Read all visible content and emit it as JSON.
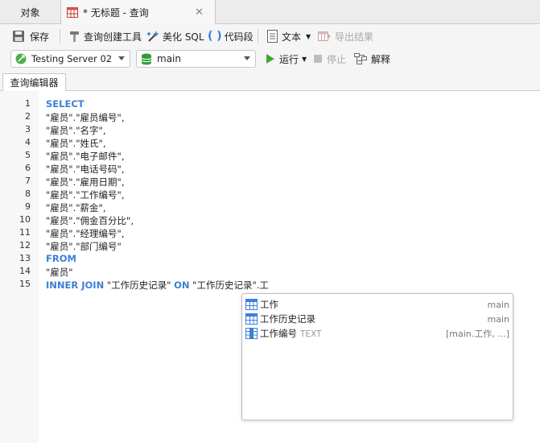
{
  "tabs": {
    "objects_label": "对象",
    "query_label": "* 无标题 - 查询",
    "close_glyph": "✕"
  },
  "toolbar": {
    "save": "保存",
    "query_builder": "查询创建工具",
    "beautify": "美化 SQL",
    "snippet": "代码段",
    "text": "文本",
    "export": "导出结果",
    "run": "运行",
    "stop": "停止",
    "explain": "解释",
    "connection": "Testing Server 02",
    "database": "main"
  },
  "editor_tab": "查询编辑器",
  "editor": {
    "line_numbers": [
      "1",
      "2",
      "3",
      "4",
      "5",
      "6",
      "7",
      "8",
      "9",
      "10",
      "11",
      "12",
      "13",
      "14",
      "15"
    ],
    "lines": [
      [
        {
          "t": "SELECT",
          "kw": true
        }
      ],
      [
        {
          "t": "\"雇员\".\"雇员编号\",",
          "kw": false
        }
      ],
      [
        {
          "t": "\"雇员\".\"名字\",",
          "kw": false
        }
      ],
      [
        {
          "t": "\"雇员\".\"姓氏\",",
          "kw": false
        }
      ],
      [
        {
          "t": "\"雇员\".\"电子邮件\",",
          "kw": false
        }
      ],
      [
        {
          "t": "\"雇员\".\"电话号码\",",
          "kw": false
        }
      ],
      [
        {
          "t": "\"雇员\".\"雇用日期\",",
          "kw": false
        }
      ],
      [
        {
          "t": "\"雇员\".\"工作编号\",",
          "kw": false
        }
      ],
      [
        {
          "t": "\"雇员\".\"薪金\",",
          "kw": false
        }
      ],
      [
        {
          "t": "\"雇员\".\"佣金百分比\",",
          "kw": false
        }
      ],
      [
        {
          "t": "\"雇员\".\"经理编号\",",
          "kw": false
        }
      ],
      [
        {
          "t": "\"雇员\".\"部门编号\"",
          "kw": false
        }
      ],
      [
        {
          "t": "FROM",
          "kw": true
        }
      ],
      [
        {
          "t": "\"雇员\"",
          "kw": false
        }
      ],
      [
        {
          "t": "INNER JOIN",
          "kw": true
        },
        {
          "t": " \"工作历史记录\" ",
          "kw": false
        },
        {
          "t": "ON",
          "kw": true
        },
        {
          "t": " \"工作历史记录\".工",
          "kw": false
        }
      ]
    ]
  },
  "autocomplete": {
    "items": [
      {
        "name": "工作",
        "type": "",
        "right": "main",
        "icon": "table-icon"
      },
      {
        "name": "工作历史记录",
        "type": "",
        "right": "main",
        "icon": "table-icon"
      },
      {
        "name": "工作编号",
        "type": "TEXT",
        "right": "[main.工作, ...]",
        "icon": "column-icon"
      }
    ]
  },
  "colors": {
    "keyword": "#3c7fd6",
    "run_green": "#3aa935",
    "db_green": "#2f9d3a"
  }
}
